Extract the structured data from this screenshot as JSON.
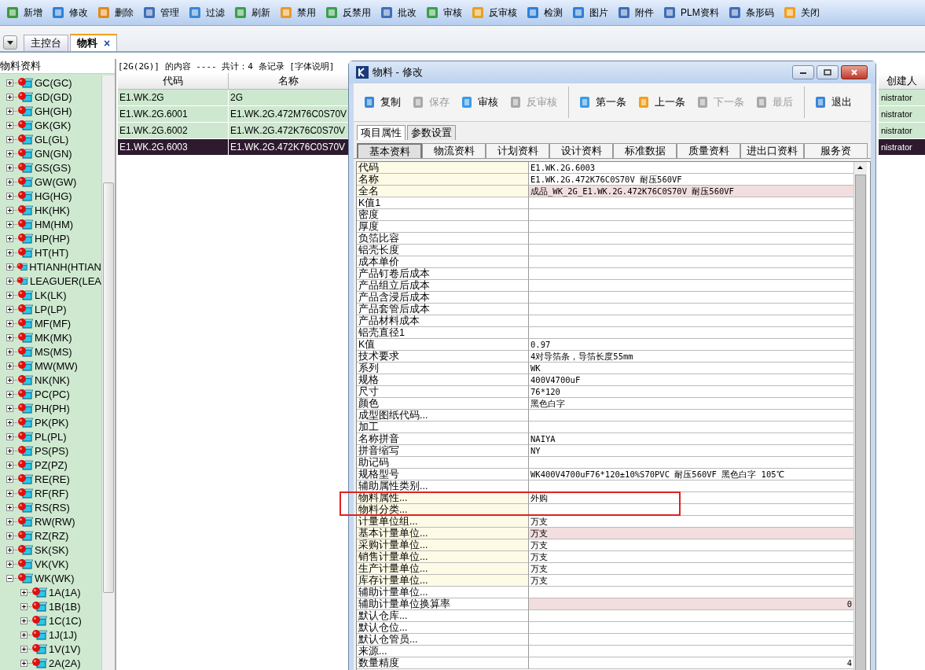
{
  "toolbar": [
    "新增",
    "修改",
    "删除",
    "管理",
    "过滤",
    "刷新",
    "禁用",
    "反禁用",
    "批改",
    "审核",
    "反审核",
    "检测",
    "图片",
    "附件",
    "PLM资料",
    "条形码",
    "关闭"
  ],
  "tabs": [
    {
      "label": "主控台",
      "selected": false
    },
    {
      "label": "物料",
      "selected": true,
      "close": "×"
    }
  ],
  "sidebar": {
    "title": "物料资料",
    "items": [
      {
        "label": "GC(GC)",
        "expanded": false
      },
      {
        "label": "GD(GD)",
        "expanded": false
      },
      {
        "label": "GH(GH)",
        "expanded": false
      },
      {
        "label": "GK(GK)",
        "expanded": false
      },
      {
        "label": "GL(GL)",
        "expanded": false
      },
      {
        "label": "GN(GN)",
        "expanded": false
      },
      {
        "label": "GS(GS)",
        "expanded": false
      },
      {
        "label": "GW(GW)",
        "expanded": false
      },
      {
        "label": "HG(HG)",
        "expanded": false
      },
      {
        "label": "HK(HK)",
        "expanded": false
      },
      {
        "label": "HM(HM)",
        "expanded": false
      },
      {
        "label": "HP(HP)",
        "expanded": false
      },
      {
        "label": "HT(HT)",
        "expanded": false
      },
      {
        "label": "HTIANH(HTIAN",
        "expanded": false
      },
      {
        "label": "LEAGUER(LEA",
        "expanded": false
      },
      {
        "label": "LK(LK)",
        "expanded": false
      },
      {
        "label": "LP(LP)",
        "expanded": false
      },
      {
        "label": "MF(MF)",
        "expanded": false
      },
      {
        "label": "MK(MK)",
        "expanded": false
      },
      {
        "label": "MS(MS)",
        "expanded": false
      },
      {
        "label": "MW(MW)",
        "expanded": false
      },
      {
        "label": "NK(NK)",
        "expanded": false
      },
      {
        "label": "PC(PC)",
        "expanded": false
      },
      {
        "label": "PH(PH)",
        "expanded": false
      },
      {
        "label": "PK(PK)",
        "expanded": false
      },
      {
        "label": "PL(PL)",
        "expanded": false
      },
      {
        "label": "PS(PS)",
        "expanded": false
      },
      {
        "label": "PZ(PZ)",
        "expanded": false
      },
      {
        "label": "RE(RE)",
        "expanded": false
      },
      {
        "label": "RF(RF)",
        "expanded": false
      },
      {
        "label": "RS(RS)",
        "expanded": false
      },
      {
        "label": "RW(RW)",
        "expanded": false
      },
      {
        "label": "RZ(RZ)",
        "expanded": false
      },
      {
        "label": "SK(SK)",
        "expanded": false
      },
      {
        "label": "VK(VK)",
        "expanded": false
      },
      {
        "label": "WK(WK)",
        "expanded": true,
        "children": [
          {
            "label": "1A(1A)",
            "expanded": false
          },
          {
            "label": "1B(1B)",
            "expanded": false
          },
          {
            "label": "1C(1C)",
            "expanded": false
          },
          {
            "label": "1J(1J)",
            "expanded": false
          },
          {
            "label": "1V(1V)",
            "expanded": false
          },
          {
            "label": "2A(2A)",
            "expanded": false
          }
        ]
      }
    ]
  },
  "info": "[2G(2G)] 的内容 ---- 共计：4 条记录  [字体说明]",
  "table": {
    "columns": [
      "代码",
      "名称",
      "创建人"
    ],
    "rows": [
      {
        "cells": [
          "E1.WK.2G",
          "2G",
          "nistrator"
        ],
        "selected": false
      },
      {
        "cells": [
          "E1.WK.2G.6001",
          "E1.WK.2G.472M76C0S70V",
          "nistrator"
        ],
        "selected": false
      },
      {
        "cells": [
          "E1.WK.2G.6002",
          "E1.WK.2G.472K76C0S70V",
          "nistrator"
        ],
        "selected": false
      },
      {
        "cells": [
          "E1.WK.2G.6003",
          "E1.WK.2G.472K76C0S70V",
          "nistrator"
        ],
        "selected": true
      }
    ]
  },
  "dialog": {
    "title": "物料 - 修改",
    "toolbar_groups": [
      [
        {
          "label": "复制",
          "disabled": false
        },
        {
          "label": "保存",
          "disabled": true
        },
        {
          "label": "审核",
          "disabled": false
        },
        {
          "label": "反审核",
          "disabled": true
        }
      ],
      [
        {
          "label": "第一条",
          "disabled": false
        },
        {
          "label": "上一条",
          "disabled": false
        },
        {
          "label": "下一条",
          "disabled": true
        },
        {
          "label": "最后",
          "disabled": true
        }
      ],
      [
        {
          "label": "退出",
          "disabled": false
        }
      ]
    ],
    "tabs": [
      {
        "label": "项目属性",
        "selected": true
      },
      {
        "label": "参数设置",
        "selected": false
      }
    ],
    "subtabs": [
      {
        "label": "基本资料",
        "selected": true
      },
      {
        "label": "物流资料",
        "selected": false
      },
      {
        "label": "计划资料",
        "selected": false
      },
      {
        "label": "设计资料",
        "selected": false
      },
      {
        "label": "标准数据",
        "selected": false
      },
      {
        "label": "质量资料",
        "selected": false
      },
      {
        "label": "进出口资料",
        "selected": false
      },
      {
        "label": "服务资",
        "selected": false
      }
    ],
    "properties": [
      {
        "label": "代码",
        "value": "E1.WK.2G.6003",
        "linked": true,
        "required": false
      },
      {
        "label": "名称",
        "value": "E1.WK.2G.472K76C0S70V 耐压560VF",
        "linked": true,
        "required": false
      },
      {
        "label": "全名",
        "value": "成品_WK_2G_E1.WK.2G.472K76C0S70V 耐压560VF",
        "linked": true,
        "required": true
      },
      {
        "label": "K值1",
        "linked": false,
        "required": false
      },
      {
        "label": "密度",
        "linked": false,
        "required": false
      },
      {
        "label": "厚度",
        "linked": false,
        "required": false
      },
      {
        "label": "负箔比容",
        "linked": false,
        "required": false
      },
      {
        "label": "铝壳长度",
        "linked": false,
        "required": false
      },
      {
        "label": "成本单价",
        "linked": false,
        "required": false
      },
      {
        "label": "产品钉卷后成本",
        "linked": false,
        "required": false
      },
      {
        "label": "产品组立后成本",
        "linked": false,
        "required": false
      },
      {
        "label": "产品含浸后成本",
        "linked": false,
        "required": false
      },
      {
        "label": "产品套管后成本",
        "linked": false,
        "required": false
      },
      {
        "label": "产品材料成本",
        "linked": false,
        "required": false
      },
      {
        "label": "铝壳直径1",
        "linked": false,
        "required": false
      },
      {
        "label": "K值",
        "value": "0.97",
        "linked": false,
        "required": false
      },
      {
        "label": "技术要求",
        "value": "4对导箔条，导箔长度55mm",
        "linked": false,
        "required": false
      },
      {
        "label": "系列",
        "value": "WK",
        "linked": false,
        "required": false
      },
      {
        "label": "规格",
        "value": "400V4700uF",
        "linked": false,
        "required": false
      },
      {
        "label": "尺寸",
        "value": "76*120",
        "linked": false,
        "required": false
      },
      {
        "label": "颜色",
        "value": "黑色白字",
        "linked": false,
        "required": false
      },
      {
        "label": "成型图纸代码...",
        "linked": false,
        "required": false
      },
      {
        "label": "加工",
        "linked": false,
        "required": false
      },
      {
        "label": "名称拼音",
        "value": "NAIYA",
        "linked": false,
        "required": false
      },
      {
        "label": "拼音缩写",
        "value": "NY",
        "linked": false,
        "required": false
      },
      {
        "label": "助记码",
        "linked": false,
        "required": false
      },
      {
        "label": "规格型号",
        "value": "WK400V4700uF76*120±10%S70PVC 耐压560VF 黑色白字 105℃",
        "linked": false,
        "required": false
      },
      {
        "label": "辅助属性类别...",
        "linked": false,
        "required": false
      },
      {
        "label": "物料属性...",
        "value": "外购",
        "linked": true,
        "required": false,
        "marked": true
      },
      {
        "label": "物料分类...",
        "linked": true,
        "required": false,
        "marked": true
      },
      {
        "label": "计量单位组...",
        "value": "万支",
        "linked": true,
        "required": false
      },
      {
        "label": "基本计量单位...",
        "value": "万支",
        "linked": true,
        "required": true
      },
      {
        "label": "采购计量单位...",
        "value": "万支",
        "linked": true,
        "required": false
      },
      {
        "label": "销售计量单位...",
        "value": "万支",
        "linked": true,
        "required": false
      },
      {
        "label": "生产计量单位...",
        "value": "万支",
        "linked": true,
        "required": false
      },
      {
        "label": "库存计量单位...",
        "value": "万支",
        "linked": true,
        "required": false
      },
      {
        "label": "辅助计量单位...",
        "linked": false,
        "required": false
      },
      {
        "label": "辅助计量单位换算率",
        "value": "0",
        "linked": false,
        "required": true,
        "numeric": true
      },
      {
        "label": "默认仓库...",
        "linked": false,
        "required": false
      },
      {
        "label": "默认仓位...",
        "linked": false,
        "required": false
      },
      {
        "label": "默认仓管员...",
        "linked": false,
        "required": false
      },
      {
        "label": "来源...",
        "linked": false,
        "required": false
      },
      {
        "label": "数量精度",
        "value": "4",
        "linked": false,
        "required": false,
        "numeric": true
      }
    ]
  }
}
